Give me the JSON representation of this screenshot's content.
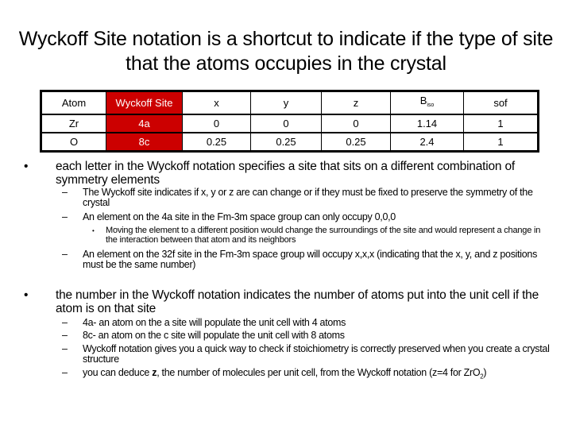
{
  "title": "Wyckoff Site notation is a shortcut to indicate if the type of site that the atoms occupies in the crystal",
  "table": {
    "headers": [
      "Atom",
      "Wyckoff Site",
      "x",
      "y",
      "z",
      "B",
      "sof"
    ],
    "biso_subscript": "iso",
    "rows": [
      [
        "Zr",
        "4a",
        "0",
        "0",
        "0",
        "1.14",
        "1"
      ],
      [
        "O",
        "8c",
        "0.25",
        "0.25",
        "0.25",
        "2.4",
        "1"
      ]
    ],
    "highlight_color": "#cc0000"
  },
  "bullets": {
    "b1": {
      "marker": "•",
      "text": "each letter in the Wyckoff notation specifies a site that sits on a different combination of symmetry elements",
      "subs": [
        {
          "marker": "–",
          "text": "The Wyckoff site indicates if x, y or z are can change or if they must be fixed to preserve the symmetry of the crystal"
        },
        {
          "marker": "–",
          "text": "An element on the 4a site in the Fm-3m space group can only occupy 0,0,0"
        },
        {
          "marker": "–",
          "text": "An element on the 32f site in the Fm-3m space group will occupy x,x,x (indicating that the x, y, and z positions must be the same number)"
        }
      ],
      "subsub": {
        "marker": "•",
        "text": "Moving the element to a different position would change the surroundings of the site and would represent a change in the interaction between that atom and its neighbors"
      }
    },
    "b2": {
      "marker": "•",
      "text": "the number in the Wyckoff notation indicates the number of atoms put into the unit cell if the atom is on that site",
      "subs": [
        {
          "marker": "–",
          "text": "4a- an atom on the a site will populate the unit cell with 4 atoms"
        },
        {
          "marker": "–",
          "text": "8c- an atom on the c site will populate the unit cell with 8 atoms"
        },
        {
          "marker": "–",
          "text": "Wyckoff notation gives you a quick way to check if stoichiometry is correctly preserved when you create a crystal structure"
        }
      ],
      "last": {
        "marker": "–",
        "pre": "you can deduce ",
        "bold": "z",
        "mid": ", the number of molecules per unit cell, from the Wyckoff notation (z=4 for ZrO",
        "subscript": "2",
        "post": ")"
      }
    }
  }
}
